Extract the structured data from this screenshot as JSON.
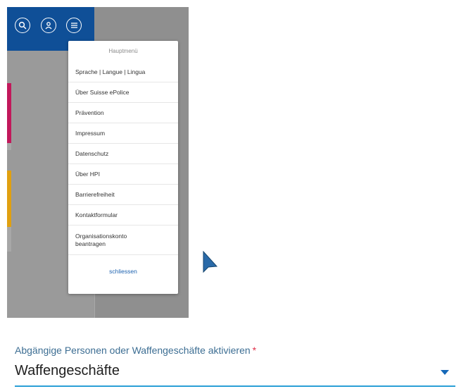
{
  "menu": {
    "title": "Hauptmenü",
    "items": [
      {
        "label": "Sprache | Langue | Lingua"
      },
      {
        "label": "Über Suisse ePolice"
      },
      {
        "label": "Prävention"
      },
      {
        "label": "Impressum"
      },
      {
        "label": "Datenschutz"
      },
      {
        "label": "Über HPI"
      },
      {
        "label": "Barrierefreiheit"
      },
      {
        "label": "Kontaktformular"
      },
      {
        "label": "Organisationskonto\nbeantragen"
      }
    ],
    "close_label": "schliessen"
  },
  "header": {
    "icons": [
      "search-icon",
      "user-icon",
      "menu-icon"
    ],
    "background": "#0f4f97"
  },
  "form": {
    "label": "Abgängige Personen oder Waffengeschäfte aktivieren",
    "required_marker": "*",
    "value": "Waffengeschäfte"
  },
  "colors": {
    "accent": "#2a9fd6",
    "label": "#3d6e93",
    "required": "#e0314b",
    "card_pink": "#c2185b",
    "card_orange": "#e0a010"
  }
}
